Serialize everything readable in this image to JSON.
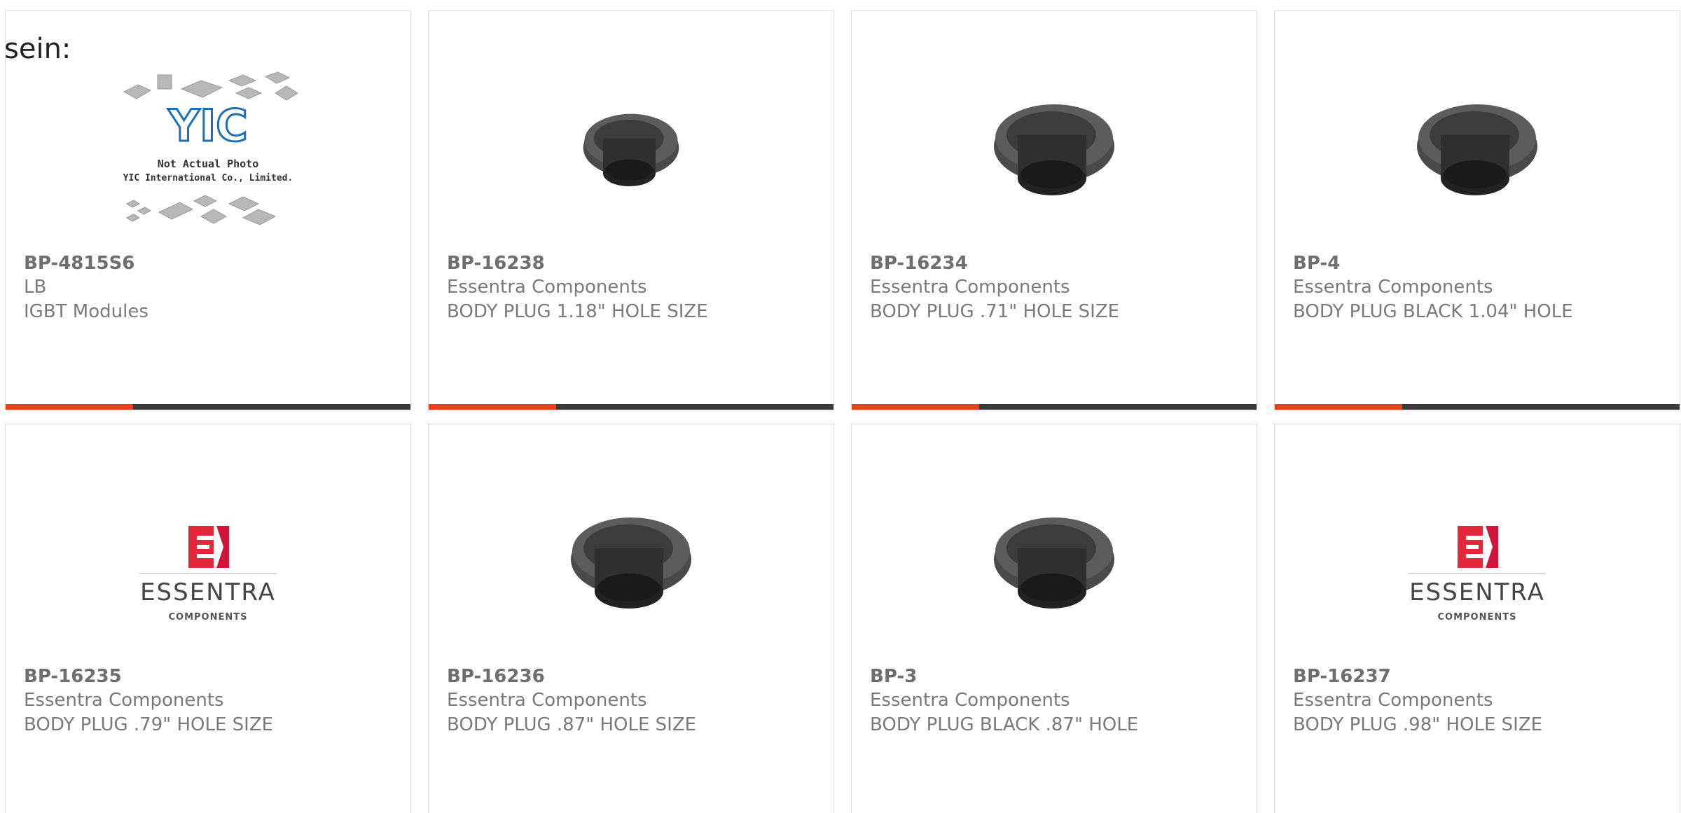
{
  "intro_text": "sein:",
  "colors": {
    "accent": "#e8401c",
    "bar": "#3a3a3a",
    "border": "#dcdcdc",
    "part_number": "#6e6e6e",
    "text": "#7a7a7a"
  },
  "placeholder_image": {
    "brand": "YIC",
    "line1": "Not Actual Photo",
    "line2": "YIC International Co., Limited."
  },
  "essentra_logo": {
    "mark": "E",
    "name": "ESSENTRA",
    "sub": "COMPONENTS"
  },
  "products": [
    {
      "part": "BP-4815S6",
      "maker": "LB",
      "desc": "IGBT Modules",
      "image": "yic-placeholder"
    },
    {
      "part": "BP-16238",
      "maker": "Essentra Components",
      "desc": "BODY PLUG 1.18\" HOLE SIZE",
      "image": "body-plug"
    },
    {
      "part": "BP-16234",
      "maker": "Essentra Components",
      "desc": "BODY PLUG .71\" HOLE SIZE",
      "image": "body-plug"
    },
    {
      "part": "BP-4",
      "maker": "Essentra Components",
      "desc": "BODY PLUG BLACK 1.04\" HOLE",
      "image": "body-plug"
    },
    {
      "part": "BP-16235",
      "maker": "Essentra Components",
      "desc": "BODY PLUG .79\" HOLE SIZE",
      "image": "essentra-logo"
    },
    {
      "part": "BP-16236",
      "maker": "Essentra Components",
      "desc": "BODY PLUG .87\" HOLE SIZE",
      "image": "body-plug"
    },
    {
      "part": "BP-3",
      "maker": "Essentra Components",
      "desc": "BODY PLUG BLACK .87\" HOLE",
      "image": "body-plug"
    },
    {
      "part": "BP-16237",
      "maker": "Essentra Components",
      "desc": "BODY PLUG .98\" HOLE SIZE",
      "image": "essentra-logo"
    }
  ]
}
